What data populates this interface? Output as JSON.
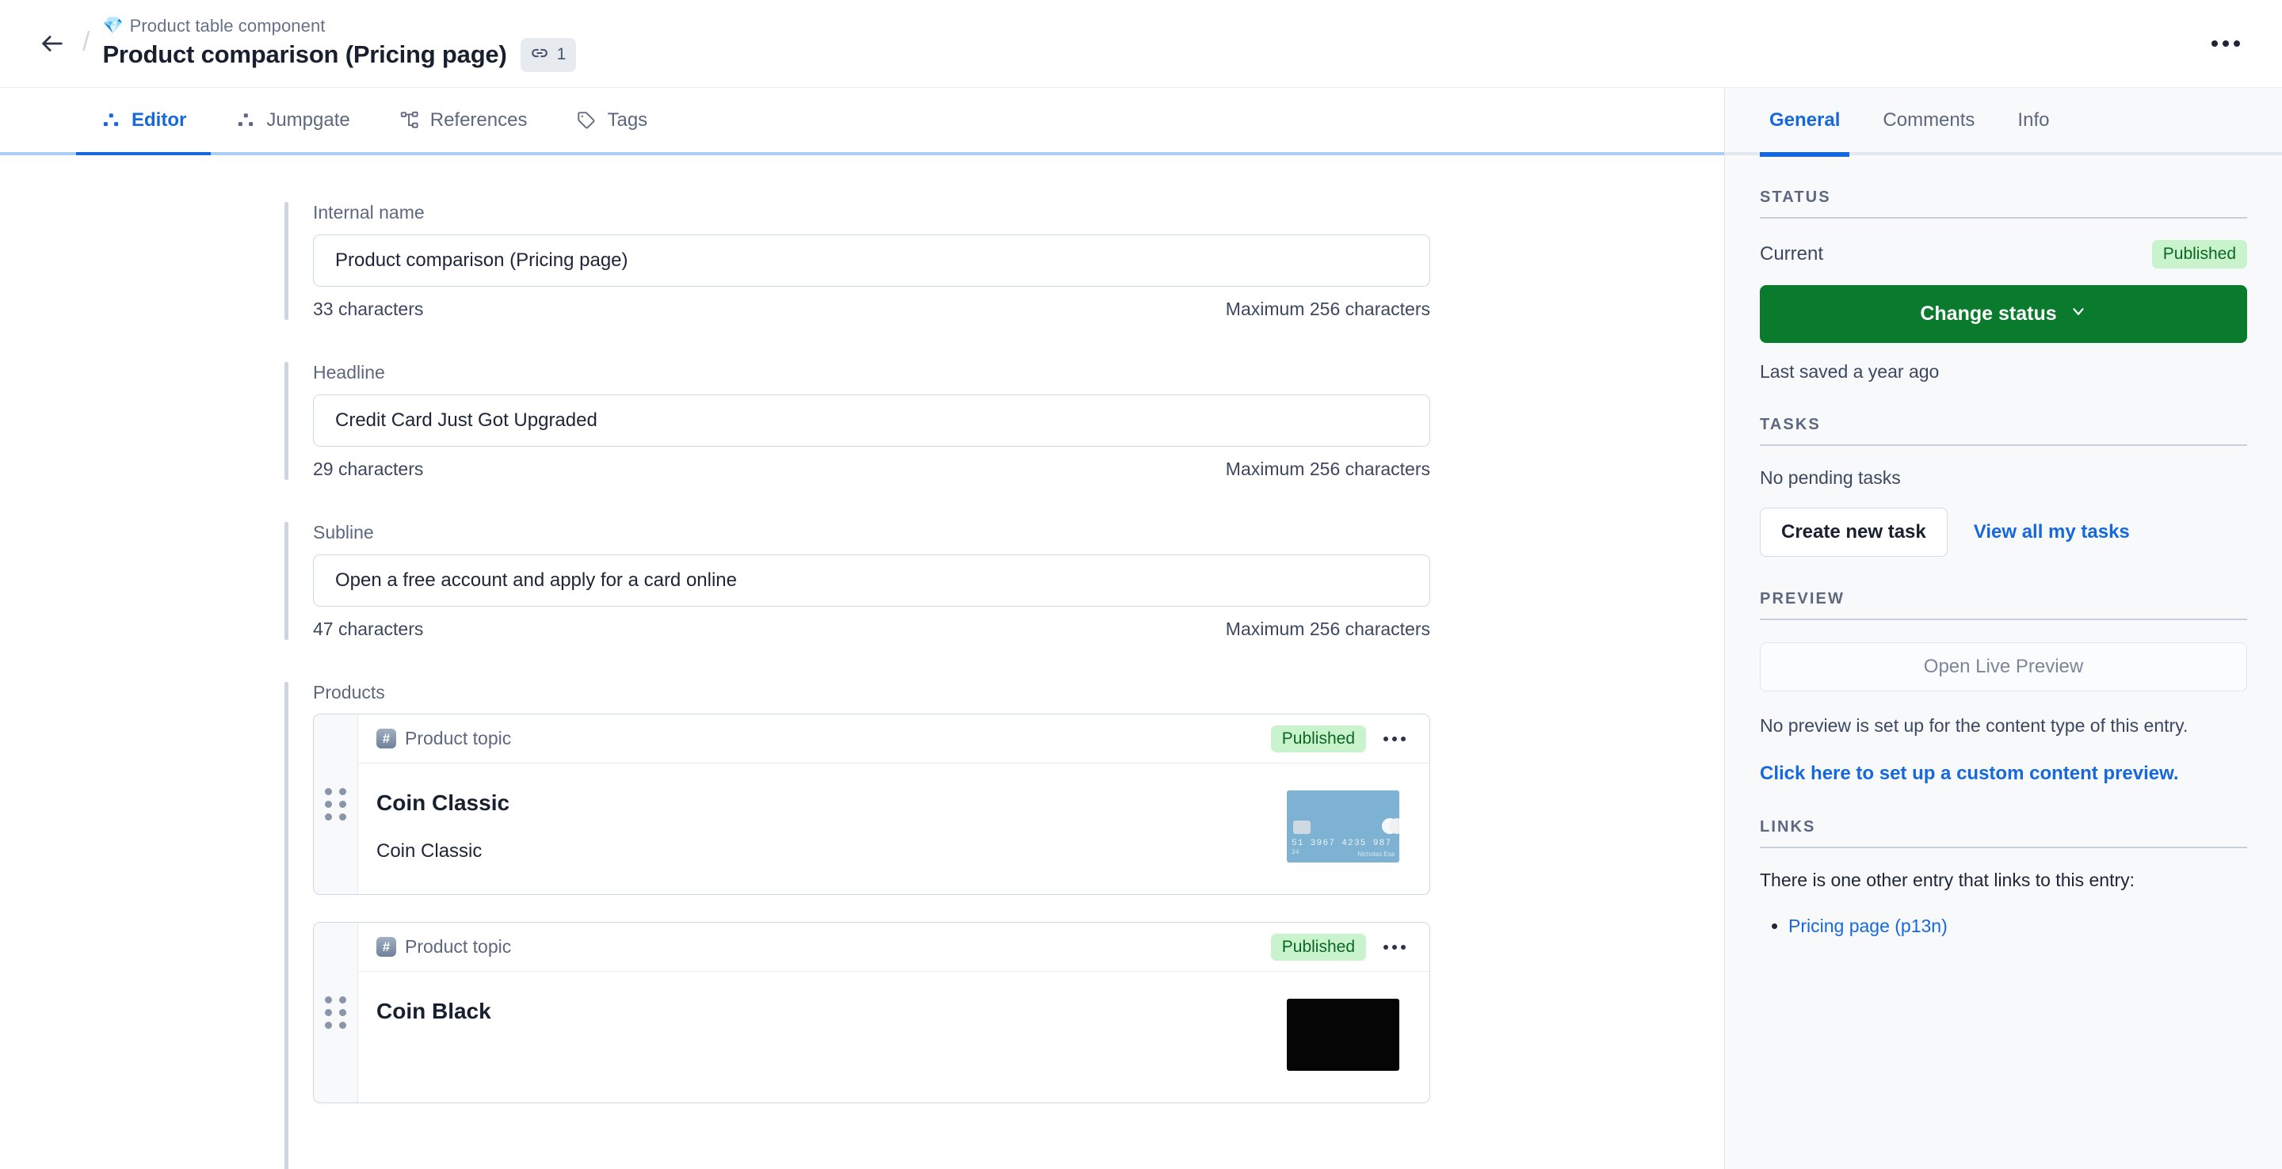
{
  "header": {
    "back_icon": "arrow-left-icon",
    "breadcrumb_icon": "gem-icon",
    "breadcrumb": "Product table component",
    "title": "Product comparison (Pricing page)",
    "link_badge": {
      "icon": "link-chain-icon",
      "count": "1"
    },
    "overflow_icon": "ellipsis-icon"
  },
  "tabs": [
    {
      "label": "Editor",
      "icon": "dots-triangle-icon",
      "active": true
    },
    {
      "label": "Jumpgate",
      "icon": "dots-triangle-icon",
      "active": false
    },
    {
      "label": "References",
      "icon": "nodes-tree-icon",
      "active": false
    },
    {
      "label": "Tags",
      "icon": "tag-icon",
      "active": false
    }
  ],
  "fields": [
    {
      "label": "Internal name",
      "value": "Product comparison (Pricing page)",
      "char_count": "33 characters",
      "max_text": "Maximum 256 characters"
    },
    {
      "label": "Headline",
      "value": "Credit Card Just Got Upgraded",
      "char_count": "29 characters",
      "max_text": "Maximum 256 characters"
    },
    {
      "label": "Subline",
      "value": "Open a free account and apply for a card online",
      "char_count": "47 characters",
      "max_text": "Maximum 256 characters"
    }
  ],
  "products": {
    "label": "Products",
    "items": [
      {
        "content_type": "Product topic",
        "content_type_icon": "hash-icon",
        "status": "Published",
        "overflow_icon": "ellipsis-icon",
        "drag_icon": "drag-handle-icon",
        "title": "Coin Classic",
        "subtitle": "Coin Classic",
        "thumb": "blue-credit-card",
        "thumb_card_number": "51 3967 4235 987",
        "thumb_card_exp": "24",
        "thumb_card_name": "Nicholas Exa"
      },
      {
        "content_type": "Product topic",
        "content_type_icon": "hash-icon",
        "status": "Published",
        "overflow_icon": "ellipsis-icon",
        "drag_icon": "drag-handle-icon",
        "title": "Coin Black",
        "subtitle": "",
        "thumb": "black-credit-card"
      }
    ]
  },
  "sidebar": {
    "tabs": [
      {
        "label": "General",
        "active": true
      },
      {
        "label": "Comments",
        "active": false
      },
      {
        "label": "Info",
        "active": false
      }
    ],
    "status": {
      "section_title": "STATUS",
      "current_label": "Current",
      "current_value": "Published",
      "change_button": "Change status",
      "change_button_icon": "chevron-down-icon",
      "last_saved": "Last saved a year ago"
    },
    "tasks": {
      "section_title": "TASKS",
      "empty_text": "No pending tasks",
      "create_button": "Create new task",
      "view_all_link": "View all my tasks"
    },
    "preview": {
      "section_title": "PREVIEW",
      "open_button": "Open Live Preview",
      "note": "No preview is set up for the content type of this entry.",
      "setup_link": "Click here to set up a custom content preview."
    },
    "links": {
      "section_title": "LINKS",
      "intro": "There is one other entry that links to this entry:",
      "items": [
        "Pricing page (p13n)"
      ]
    }
  },
  "colors": {
    "accent_blue": "#1668dc",
    "publish_green": "#0a7b2d",
    "badge_green_bg": "#c9f3cd",
    "badge_green_fg": "#0b6623",
    "panel_bg": "#f7f9fb"
  }
}
